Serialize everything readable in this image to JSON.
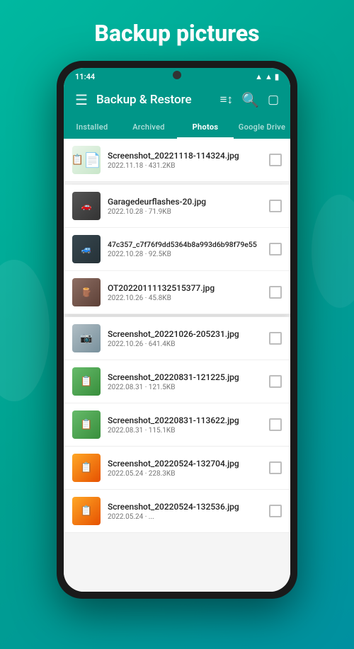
{
  "page": {
    "title": "Backup pictures",
    "background_color": "#00b8a0"
  },
  "status_bar": {
    "time": "11:44",
    "signal_icon": "▲",
    "wifi_icon": "wifi",
    "battery_icon": "🔋"
  },
  "app_bar": {
    "title": "Backup & Restore",
    "menu_icon": "☰",
    "filter_icon": "≡",
    "search_icon": "🔍",
    "view_icon": "⬜"
  },
  "tabs": [
    {
      "label": "Installed",
      "active": false
    },
    {
      "label": "Archived",
      "active": false
    },
    {
      "label": "Photos",
      "active": true
    },
    {
      "label": "Google Drive",
      "active": false
    }
  ],
  "files": [
    {
      "name": "Screenshot_20221118-114324.jpg",
      "meta": "2022.11.18 · 431.2KB",
      "thumb_type": "screenshot",
      "elevated": false
    },
    {
      "name": "Garagedeurflashes-20.jpg",
      "meta": "2022.10.28 · 71.9KB",
      "thumb_type": "garage",
      "elevated": true
    },
    {
      "name": "47c357_c7f76f9dd5364b8a993d6b98f79e55",
      "meta": "2022.10.28 · 92.5KB",
      "thumb_type": "car",
      "elevated": true
    },
    {
      "name": "OT20220111132515377.jpg",
      "meta": "2022.10.26 · 45.8KB",
      "thumb_type": "woodwork",
      "elevated": true
    },
    {
      "name": "Screenshot_20221026-205231.jpg",
      "meta": "2022.10.26 · 641.4KB",
      "thumb_type": "screen2",
      "elevated": false
    },
    {
      "name": "Screenshot_20220831-121225.jpg",
      "meta": "2022.08.31 · 121.5KB",
      "thumb_type": "green",
      "elevated": false
    },
    {
      "name": "Screenshot_20220831-113622.jpg",
      "meta": "2022.08.31 · 115.1KB",
      "thumb_type": "green",
      "elevated": false
    },
    {
      "name": "Screenshot_20220524-132704.jpg",
      "meta": "2022.05.24 · 228.3KB",
      "thumb_type": "orange",
      "elevated": false
    },
    {
      "name": "Screenshot_20220524-132536.jpg",
      "meta": "2022.05.24 · ...",
      "thumb_type": "orange",
      "elevated": false
    }
  ]
}
